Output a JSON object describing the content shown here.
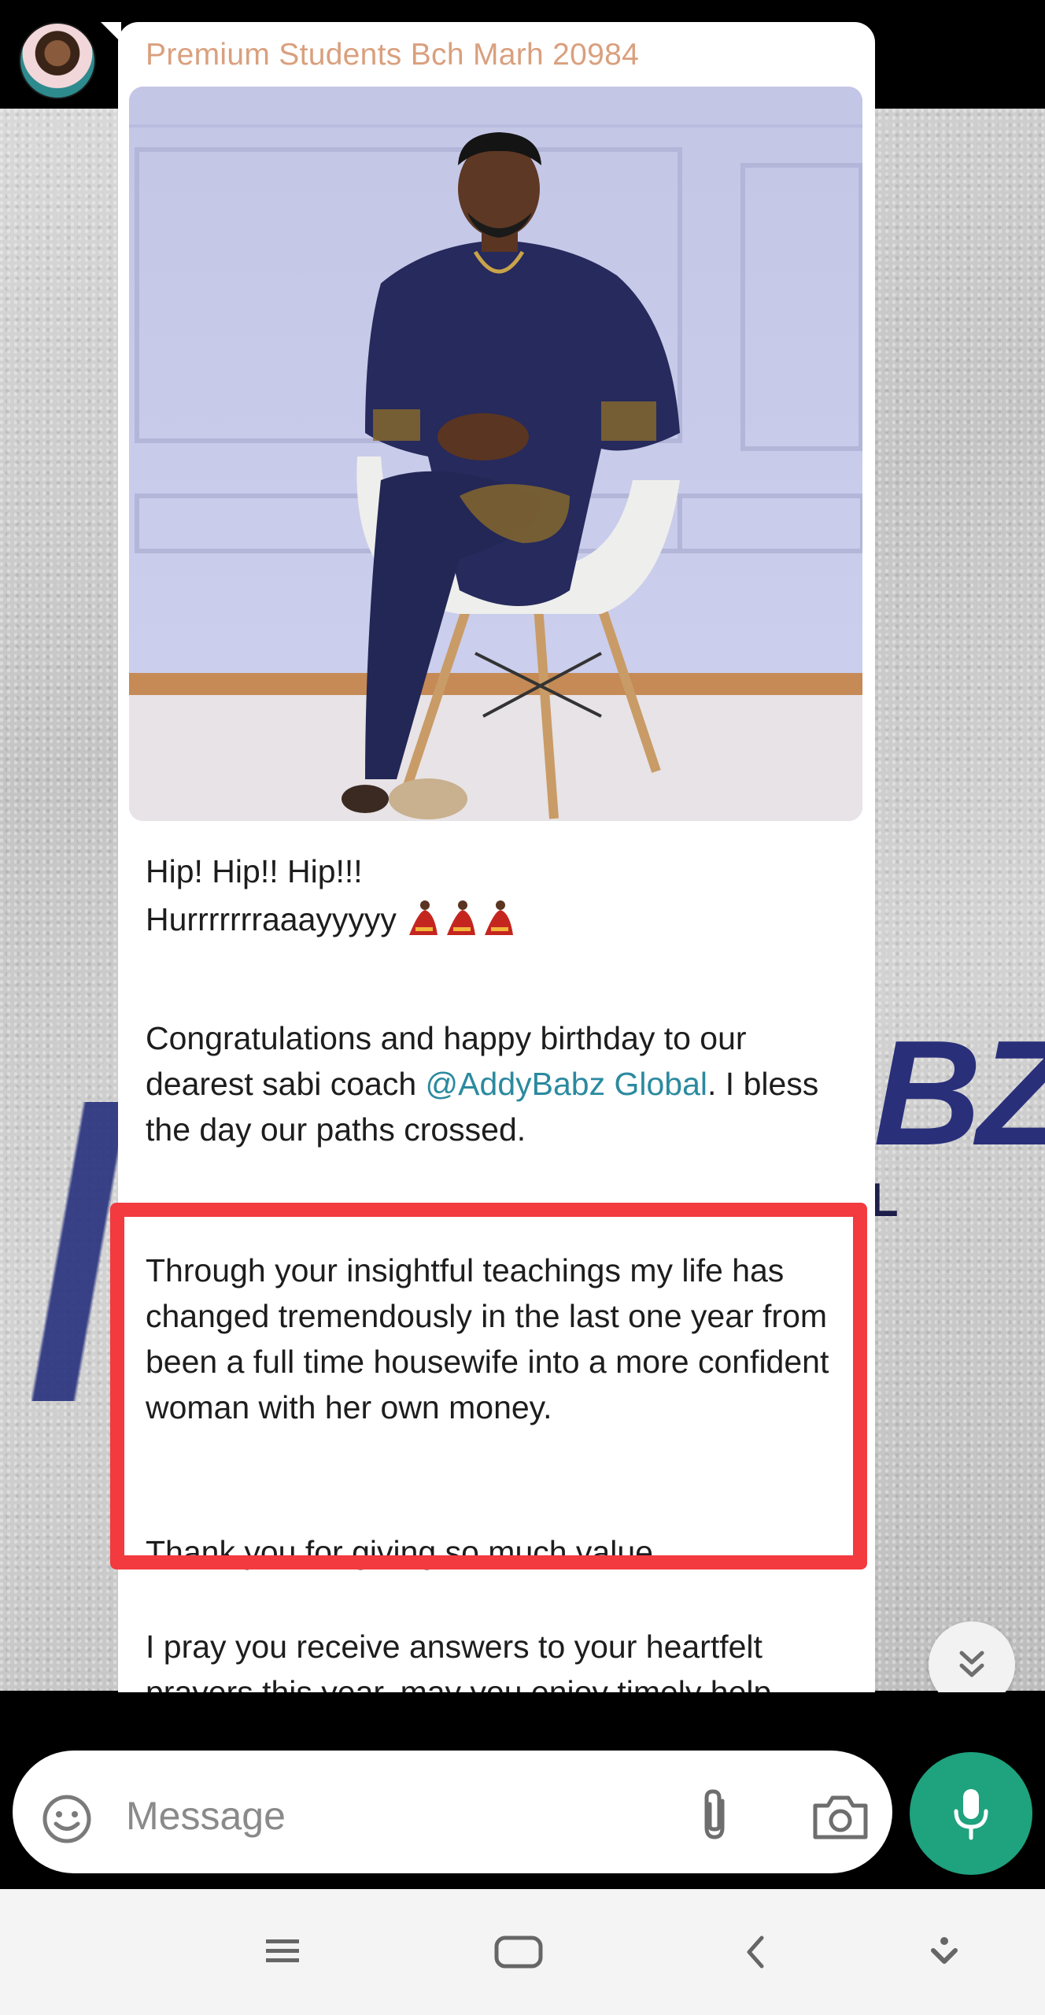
{
  "chat": {
    "sender_name": "Premium Students Bch Marh 20984",
    "photo_sticker_text": "",
    "message": {
      "line_hip": "Hip! Hip!! Hip!!!",
      "line_hurray": "Hurrrrrrraaayyyyy",
      "congrats_before_mention": "Congratulations and happy birthday to our dearest sabi coach ",
      "mention_line1": "@AddyBabz",
      "mention_line2": "Global",
      "congrats_after_mention": ". I bless the day our paths crossed.",
      "highlight_para1": "Through your insightful teachings my life has changed tremendously in the last one year from been a full time housewife into a more confident woman with her own money.",
      "highlight_para2": "Thank you for giving so much value.",
      "closing_partial": "I pray you receive answers to your heartfelt prayers this year, may you enjoy timely help from both God and"
    }
  },
  "composer": {
    "placeholder": "Message"
  },
  "icons": {
    "emoji": "emoji-icon",
    "attach": "paperclip-icon",
    "camera": "camera-icon",
    "mic": "microphone-icon",
    "scroll": "double-chevron-down-icon",
    "nav_menu": "recents-icon",
    "nav_home": "home-icon",
    "nav_back": "back-icon",
    "nav_extra": "hide-nav-icon"
  },
  "colors": {
    "sender_name": "#d9a07e",
    "mention": "#2b8a9f",
    "highlight_border": "#f23a3f",
    "mic_button": "#1fa27e"
  }
}
